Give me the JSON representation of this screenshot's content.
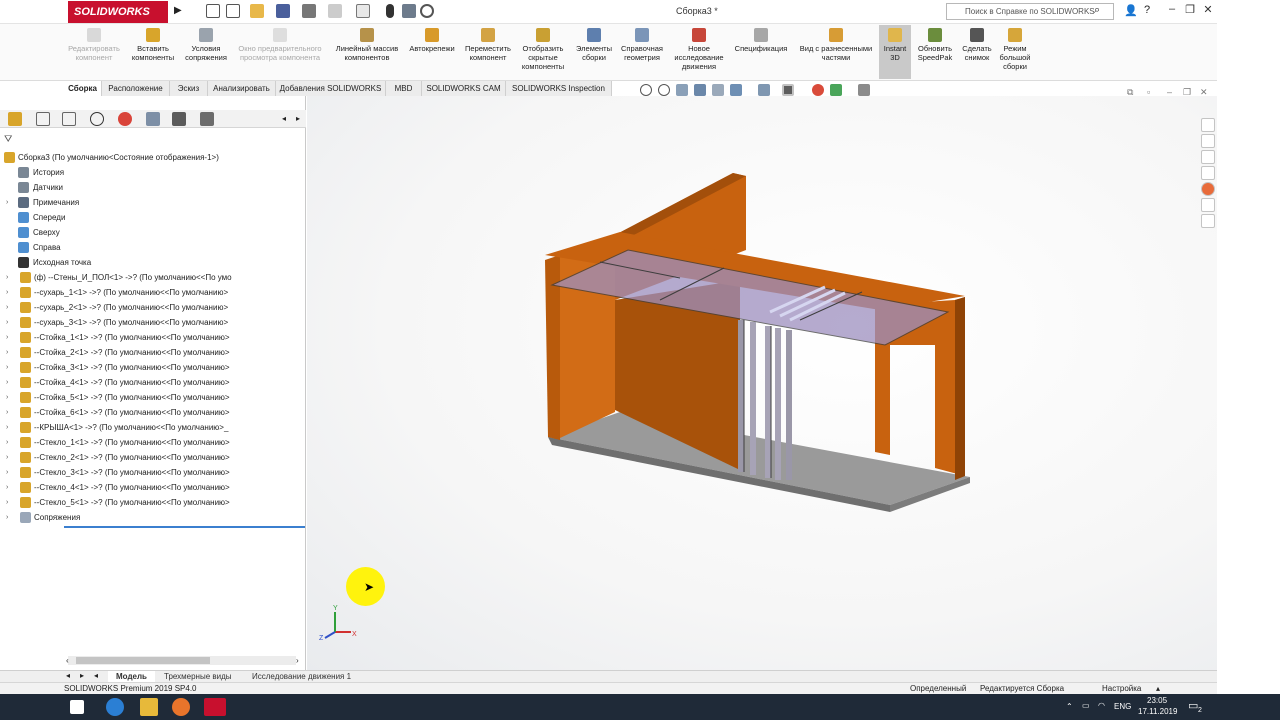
{
  "app": {
    "logo_text": "SOLIDWORKS",
    "document_title": "Сборка3 *",
    "help_search_placeholder": "Поиск в Справке по SOLIDWORKS"
  },
  "commands": [
    {
      "label": "Редактировать\nкомпонент",
      "icon": "edit-component-icon",
      "enabled": false
    },
    {
      "label": "Вставить\nкомпоненты",
      "icon": "insert-components-icon",
      "enabled": true
    },
    {
      "label": "Условия\nсопряжения",
      "icon": "mate-icon",
      "enabled": true
    },
    {
      "label": "Окно предварительного\nпросмотра компонента",
      "icon": "preview-window-icon",
      "enabled": false
    },
    {
      "label": "Линейный массив\nкомпонентов",
      "icon": "linear-pattern-icon",
      "enabled": true
    },
    {
      "label": "Автокрепежи",
      "icon": "smart-fasteners-icon",
      "enabled": true
    },
    {
      "label": "Переместить\nкомпонент",
      "icon": "move-component-icon",
      "enabled": true
    },
    {
      "label": "Отобразить\nскрытые\nкомпоненты",
      "icon": "show-hidden-icon",
      "enabled": true
    },
    {
      "label": "Элементы\nсборки",
      "icon": "assembly-features-icon",
      "enabled": true
    },
    {
      "label": "Справочная\nгеометрия",
      "icon": "reference-geometry-icon",
      "enabled": true
    },
    {
      "label": "Новое\nисследование\nдвижения",
      "icon": "motion-study-icon",
      "enabled": true
    },
    {
      "label": "Спецификация",
      "icon": "bom-icon",
      "enabled": true
    },
    {
      "label": "Вид с разнесенными\nчастями",
      "icon": "exploded-view-icon",
      "enabled": true
    },
    {
      "label": "Instant\n3D",
      "icon": "instant3d-icon",
      "enabled": true
    },
    {
      "label": "Обновить\nSpeedPak",
      "icon": "speedpak-icon",
      "enabled": true
    },
    {
      "label": "Сделать\nснимок",
      "icon": "snapshot-icon",
      "enabled": true
    },
    {
      "label": "Режим\nбольшой\nсборки",
      "icon": "large-assembly-icon",
      "enabled": true
    }
  ],
  "ribbon_tabs": [
    "Сборка",
    "Расположение",
    "Эскиз",
    "Анализировать",
    "Добавления SOLIDWORKS",
    "MBD",
    "SOLIDWORKS CAM",
    "SOLIDWORKS Inspection"
  ],
  "tree": {
    "root": "Сборка3  (По умолчанию<Состояние отображения-1>)",
    "items": [
      {
        "label": "История",
        "icon": "history-icon",
        "expandable": false
      },
      {
        "label": "Датчики",
        "icon": "sensor-icon",
        "expandable": false
      },
      {
        "label": "Примечания",
        "icon": "annotations-icon",
        "expandable": true
      },
      {
        "label": "Спереди",
        "icon": "plane-icon",
        "expandable": false
      },
      {
        "label": "Сверху",
        "icon": "plane-icon",
        "expandable": false
      },
      {
        "label": "Справа",
        "icon": "plane-icon",
        "expandable": false
      },
      {
        "label": "Исходная точка",
        "icon": "origin-icon",
        "expandable": false
      },
      {
        "label": "(ф) --Стены_И_ПОЛ<1> ->? (По умолчанию<<По умо",
        "icon": "part-icon",
        "expandable": true
      },
      {
        "label": "--сухарь_1<1> ->? (По умолчанию<<По умолчанию>",
        "icon": "part-icon",
        "expandable": true
      },
      {
        "label": "--сухарь_2<1> ->? (По умолчанию<<По умолчанию>",
        "icon": "part-icon",
        "expandable": true
      },
      {
        "label": "--сухарь_3<1> ->? (По умолчанию<<По умолчанию>",
        "icon": "part-icon",
        "expandable": true
      },
      {
        "label": "--Стойка_1<1> ->? (По умолчанию<<По умолчанию>",
        "icon": "part-icon",
        "expandable": true
      },
      {
        "label": "--Стойка_2<1> ->? (По умолчанию<<По умолчанию>",
        "icon": "part-icon",
        "expandable": true
      },
      {
        "label": "--Стойка_3<1> ->? (По умолчанию<<По умолчанию>",
        "icon": "part-icon",
        "expandable": true
      },
      {
        "label": "--Стойка_4<1> ->? (По умолчанию<<По умолчанию>",
        "icon": "part-icon",
        "expandable": true
      },
      {
        "label": "--Стойка_5<1> ->? (По умолчанию<<По умолчанию>",
        "icon": "part-icon",
        "expandable": true
      },
      {
        "label": "--Стойка_6<1> ->? (По умолчанию<<По умолчанию>",
        "icon": "part-icon",
        "expandable": true
      },
      {
        "label": "--КРЫША<1> ->? (По умолчанию<<По умолчанию>_",
        "icon": "part-icon",
        "expandable": true
      },
      {
        "label": "--Стекло_1<1> ->? (По умолчанию<<По умолчанию>",
        "icon": "part-icon",
        "expandable": true
      },
      {
        "label": "--Стекло_2<1> ->? (По умолчанию<<По умолчанию>",
        "icon": "part-icon",
        "expandable": true
      },
      {
        "label": "--Стекло_3<1> ->? (По умолчанию<<По умолчанию>",
        "icon": "part-icon",
        "expandable": true
      },
      {
        "label": "--Стекло_4<1> ->? (По умолчанию<<По умолчанию>",
        "icon": "part-icon",
        "expandable": true
      },
      {
        "label": "--Стекло_5<1> ->? (По умолчанию<<По умолчанию>",
        "icon": "part-icon",
        "expandable": true
      },
      {
        "label": "Сопряжения",
        "icon": "mates-folder-icon",
        "expandable": true
      }
    ]
  },
  "bottom_tabs": [
    "Модель",
    "Трехмерные виды",
    "Исследование движения 1"
  ],
  "status": {
    "product": "SOLIDWORKS Premium 2019 SP4.0",
    "state": "Определенный",
    "mode": "Редактируется Сборка",
    "custom": "Настройка"
  },
  "taskbar": {
    "lang": "ENG",
    "time": "23:05",
    "date": "17.11.2019",
    "notifications": "2"
  },
  "triad": {
    "x": "X",
    "y": "Y",
    "z": "Z"
  },
  "colors": {
    "brand": "#c8102e",
    "wood": "#c8620f",
    "wood_dark": "#8f4306",
    "floor": "#8d8d8d",
    "glass": "#9d8fbf",
    "selection": "#3b7fcf"
  }
}
